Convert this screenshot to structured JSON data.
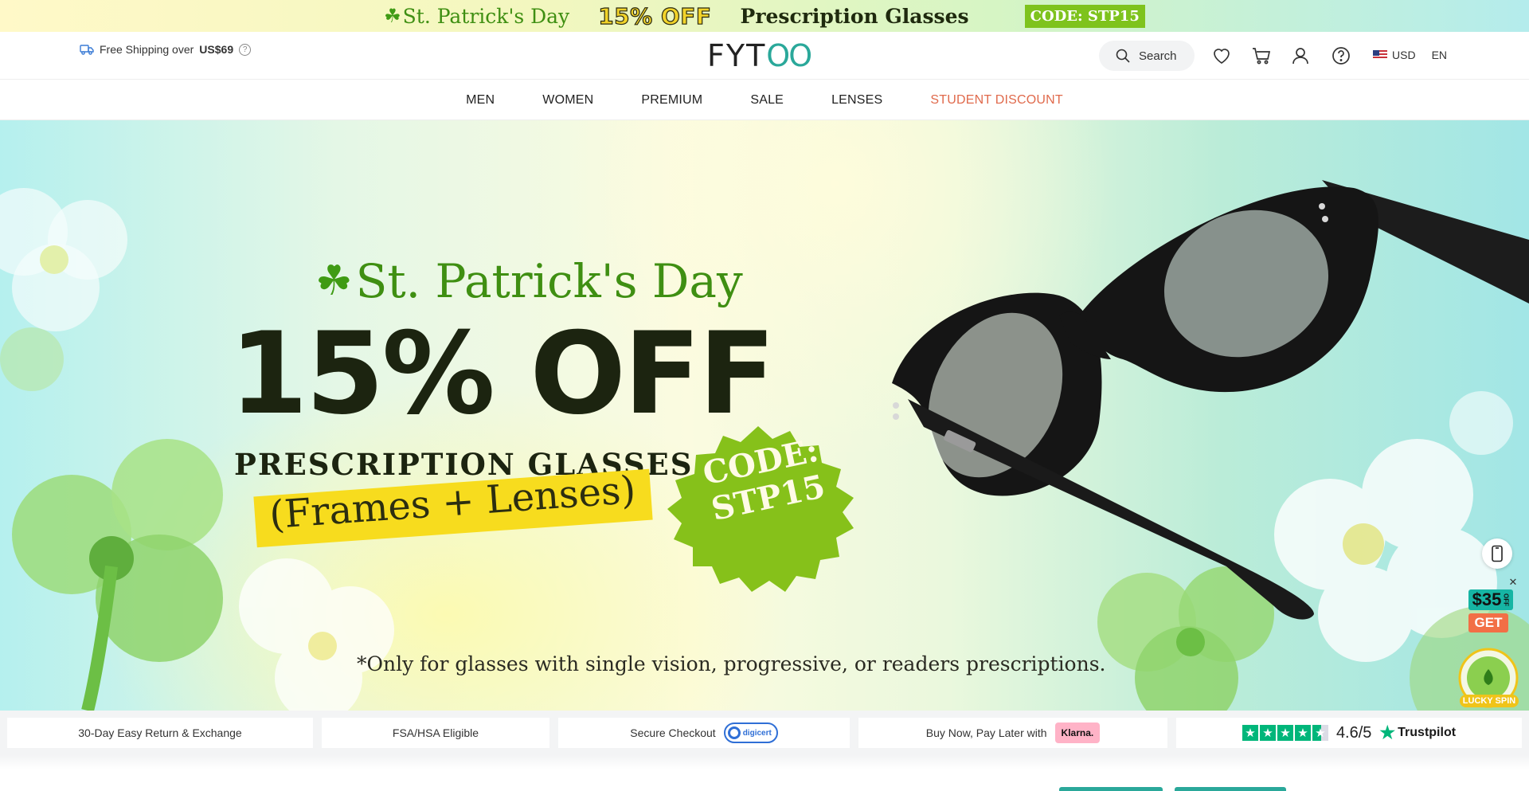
{
  "promo": {
    "holiday": "St. Patrick's Day",
    "offer": "15% OFF",
    "product": "Prescription Glasses",
    "code": "CODE: STP15"
  },
  "header": {
    "shipping_label": "Free Shipping over",
    "shipping_amount": "US$69",
    "logo_start": "FYT",
    "logo_end": "OO",
    "search_label": "Search",
    "currency": "USD",
    "language": "EN"
  },
  "nav": {
    "items": [
      {
        "label": "MEN"
      },
      {
        "label": "WOMEN"
      },
      {
        "label": "PREMIUM"
      },
      {
        "label": "SALE"
      },
      {
        "label": "LENSES"
      },
      {
        "label": "STUDENT DISCOUNT"
      }
    ]
  },
  "hero": {
    "holiday": "St. Patrick's Day",
    "offer": "15% OFF",
    "product": "PRESCRIPTION GLASSES",
    "frames": "(Frames + Lenses)",
    "code_line1": "CODE:",
    "code_line2": "STP15",
    "disclaimer": "*Only for glasses with single vision, progressive, or readers prescriptions."
  },
  "widgets": {
    "coupon_amount": "$35",
    "coupon_off": "OFF",
    "coupon_cta": "GET",
    "spin_label": "LUCKY SPIN"
  },
  "trust": {
    "return": "30-Day Easy Return & Exchange",
    "fsa": "FSA/HSA Eligible",
    "checkout": "Secure Checkout",
    "digicert": "digicert",
    "bnpl": "Buy Now, Pay Later with",
    "klarna": "Klarna.",
    "rating": "4.6/5",
    "rating_stars": 4.6,
    "trustpilot": "Trustpilot"
  },
  "colors": {
    "brand_teal": "#2aa89a",
    "accent_green": "#7ec31d",
    "student_link": "#e06a4c",
    "trustpilot_green": "#00b67a"
  }
}
